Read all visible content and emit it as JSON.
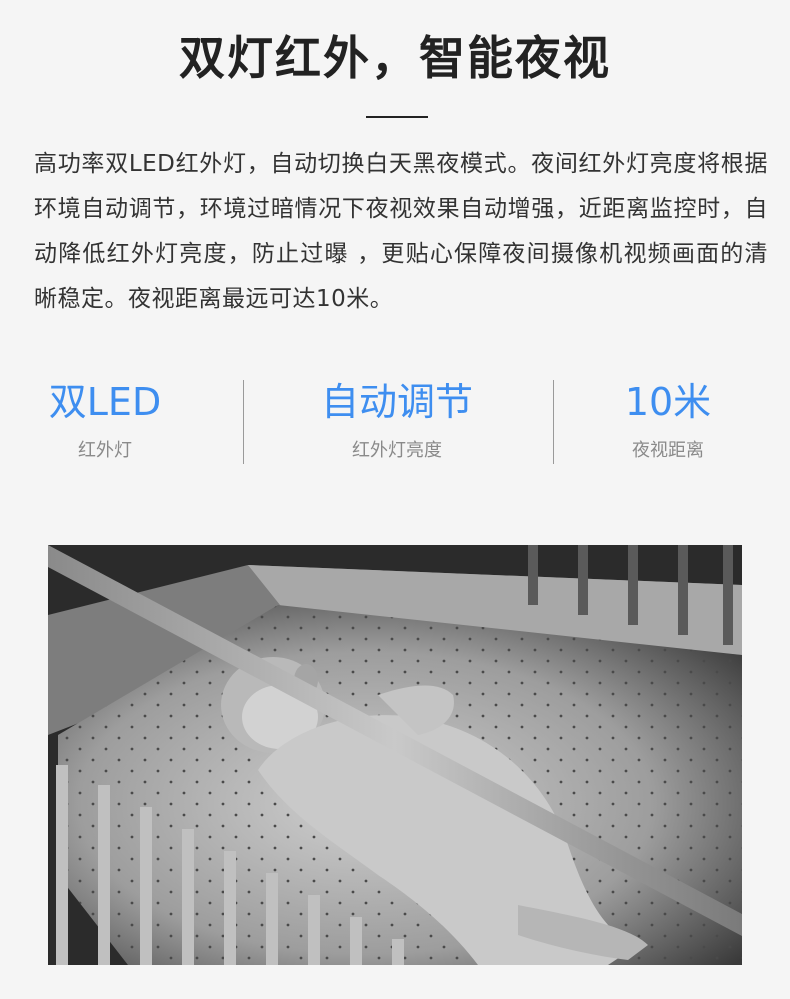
{
  "header": {
    "title": "双灯红外，智能夜视"
  },
  "description": "高功率双LED红外灯，自动切换白天黑夜模式。夜间红外灯亮度将根据环境自动调节，环境过暗情况下夜视效果自动增强，近距离监控时，自动降低红外灯亮度，防止过曝 ，更贴心保障夜间摄像机视频画面的清晰稳定。夜视距离最远可达10米。",
  "stats": [
    {
      "value": "双LED",
      "label": "红外灯"
    },
    {
      "value": "自动调节",
      "label": "红外灯亮度"
    },
    {
      "value": "10米",
      "label": "夜视距离"
    }
  ],
  "colors": {
    "accent": "#3e8ef0",
    "background": "#f5f5f5",
    "title": "#222222"
  }
}
